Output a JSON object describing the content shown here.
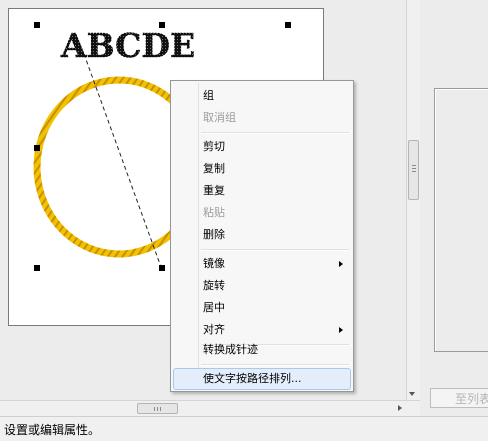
{
  "canvas": {
    "text_object": "ABCDE"
  },
  "context_menu": {
    "items": [
      {
        "label": "组",
        "disabled": false
      },
      {
        "label": "取消组",
        "disabled": true
      },
      {
        "label": "剪切",
        "disabled": false
      },
      {
        "label": "复制",
        "disabled": false
      },
      {
        "label": "重复",
        "disabled": false
      },
      {
        "label": "粘贴",
        "disabled": true
      },
      {
        "label": "删除",
        "disabled": false
      },
      {
        "label": "镜像",
        "disabled": false,
        "submenu": true
      },
      {
        "label": "旋转",
        "disabled": false
      },
      {
        "label": "居中",
        "disabled": false
      },
      {
        "label": "对齐",
        "disabled": false,
        "submenu": true
      },
      {
        "label": "转换成针迹",
        "disabled": false
      },
      {
        "label": "使文字按路径排列...",
        "disabled": false,
        "highlighted": true
      }
    ]
  },
  "right_panel": {
    "button_label": "至列表"
  },
  "status_bar": {
    "text": "设置或编辑属性。"
  },
  "colors": {
    "ellipse_stitch": "#e0a800",
    "menu_highlight": "#e4eefb"
  }
}
